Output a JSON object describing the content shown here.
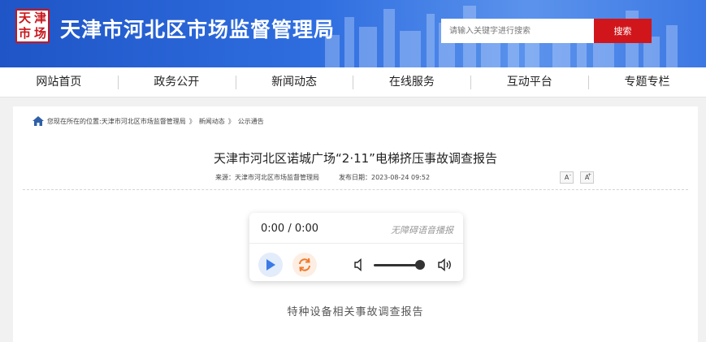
{
  "header": {
    "logo_chars": [
      "天",
      "津",
      "市",
      "场"
    ],
    "title": "天津市河北区市场监督管理局",
    "search_placeholder": "请输入关键字进行搜索",
    "search_button": "搜索"
  },
  "nav": [
    "网站首页",
    "政务公开",
    "新闻动态",
    "在线服务",
    "互动平台",
    "专题专栏"
  ],
  "breadcrumb": {
    "prefix": "您现在所在的位置:",
    "items": [
      "天津市河北区市场监督管理局",
      "新闻动态",
      "公示通告"
    ],
    "separator": "》"
  },
  "article": {
    "title": "天津市河北区诺城广场“2·11”电梯挤压事故调查报告",
    "source": "来源：天津市河北区市场监督管理局",
    "date": "发布日期：2023-08-24 09:52",
    "font_decrease": "A",
    "font_decrease_sign": "-",
    "font_increase": "A",
    "font_increase_sign": "+",
    "body_first_line": "特种设备相关事故调查报告"
  },
  "player": {
    "time": "0:00 / 0:00",
    "label": "无障碍语音播报",
    "volume_level": 0.9
  },
  "colors": {
    "header_blue": "#2f6ee0",
    "search_red": "#d0161b",
    "play_blue": "#3b7be8",
    "loop_orange": "#f07a2a"
  }
}
